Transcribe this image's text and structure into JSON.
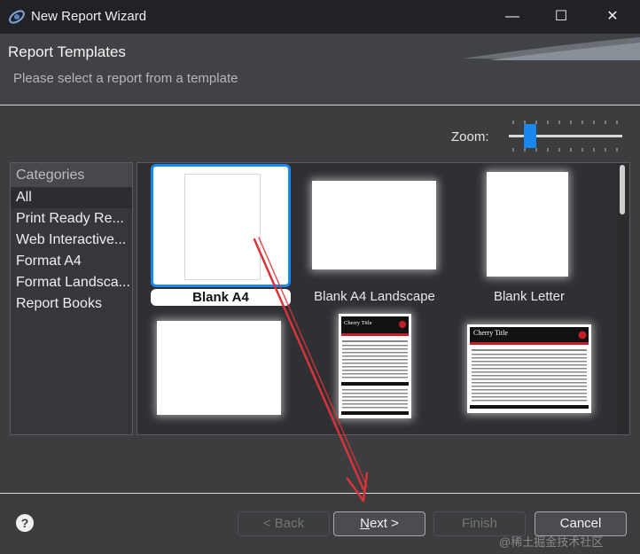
{
  "window": {
    "title": "New Report Wizard",
    "minimize_glyph": "—",
    "maximize_glyph": "☐",
    "close_glyph": "✕"
  },
  "header": {
    "title": "Report Templates",
    "description": "Please select a report from a template"
  },
  "zoom": {
    "label": "Zoom:",
    "level_fraction": 0.15
  },
  "categories": {
    "heading": "Categories",
    "items": [
      {
        "label": "All",
        "selected": true
      },
      {
        "label": "Print Ready Re..."
      },
      {
        "label": "Web Interactive..."
      },
      {
        "label": "Format A4"
      },
      {
        "label": "Format Landsca..."
      },
      {
        "label": "Report Books"
      }
    ]
  },
  "templates": [
    {
      "label": "Blank A4",
      "selected": true
    },
    {
      "label": "Blank A4 Landscape"
    },
    {
      "label": "Blank Letter"
    },
    {
      "label": ""
    },
    {
      "label": "",
      "preview_title": "Cherry Title"
    },
    {
      "label": "",
      "preview_title": "Cherry Title"
    }
  ],
  "buttons": {
    "back": "< Back",
    "next_mnemonic": "N",
    "next_rest": "ext >",
    "finish": "Finish",
    "cancel": "Cancel",
    "help": "?"
  },
  "watermark": "@稀土掘金技术社区",
  "colors": {
    "accent": "#1a86ef",
    "annotation_arrow": "#d9333a"
  }
}
